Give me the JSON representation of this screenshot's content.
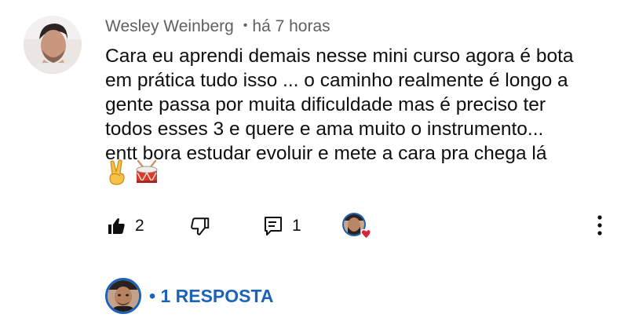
{
  "comment": {
    "author": "Wesley Weinberg",
    "separator": "•",
    "time": "há 7 horas",
    "lines": [
      "Cara eu aprendi demais nesse mini curso agora é bota",
      "em prática tudo isso ... o caminho realmente é longo a",
      "gente passa por muita dificuldade mas é preciso ter",
      "todos esses 3 e quere e ama muito o instrumento...",
      "entt bora estudar evoluir e mete a cara pra chega lá"
    ],
    "emojis": [
      "victory-hand-emoji",
      "drum-emoji"
    ]
  },
  "actions": {
    "like_icon": "thumbs-up-filled-icon",
    "like_count": "2",
    "dislike_icon": "thumbs-down-outline-icon",
    "reply_icon": "comment-reply-icon",
    "reply_count": "1",
    "creator_heart": "creator-heart-avatar-icon",
    "more_icon": "more-vertical-icon"
  },
  "replies": {
    "label": "• 1 RESPOSTA"
  },
  "colors": {
    "text": "#0f0f0f",
    "meta": "#606060",
    "link": "#1c62b9",
    "heart": "#e0243a"
  }
}
